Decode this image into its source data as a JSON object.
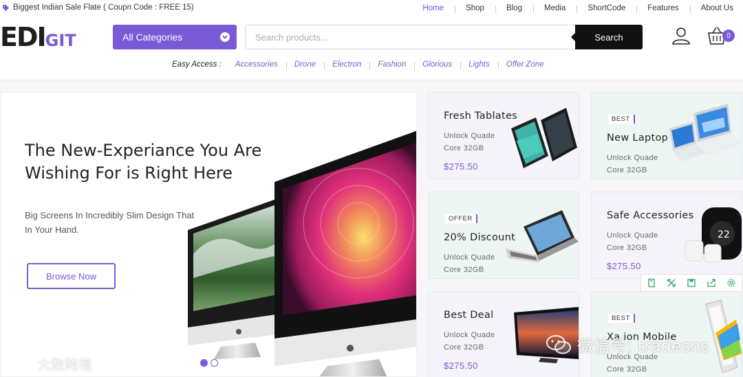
{
  "topbar": {
    "promo": "Biggest Indian Sale Flate ( Coupn Code : FREE 15)",
    "nav": [
      "Home",
      "Shop",
      "Blog",
      "Media",
      "ShortCode",
      "Features",
      "About Us"
    ],
    "active_nav": "Home"
  },
  "logo": {
    "main": "EDI",
    "accent": "GIT"
  },
  "header": {
    "categories_label": "All Categories",
    "search_placeholder": "Search products...",
    "search_button": "Search",
    "cart_count": "0"
  },
  "easy_access": {
    "label": "Easy Access :",
    "links": [
      "Accessories",
      "Drone",
      "Electron",
      "Fashion",
      "Glorious",
      "Lights",
      "Offer Zone"
    ]
  },
  "hero": {
    "title": "The New-Experiance You Are Wishing For is Right Here",
    "subtitle": "Big Screens In Incredibly Slim Design That In Your Hand.",
    "button": "Browse Now",
    "slides_total": 2,
    "slide_active": 1
  },
  "products": [
    {
      "badge": "",
      "name": "Fresh Tablates",
      "desc": "Unlock Quade Core 32GB",
      "price": "$275.50",
      "image": "tablet-image"
    },
    {
      "badge": "BEST",
      "name": "New Laptop",
      "desc": "Unlock Quade Core 32GB",
      "price": "",
      "image": "laptop-image"
    },
    {
      "badge": "OFFER",
      "name": "20% Discount",
      "desc": "Unlock Quade Core 32GB",
      "price": "",
      "image": "keyboard-tablet-image"
    },
    {
      "badge": "",
      "name": "Safe Accessories",
      "desc": "Unlock Quade Core 32GB",
      "price": "$275.50",
      "image": "thermostat-image"
    },
    {
      "badge": "",
      "name": "Best Deal",
      "desc": "Unlock Quade Core 32GB",
      "price": "$275.50",
      "image": "tv-image"
    },
    {
      "badge": "BEST",
      "name": "Xa  ion Mobile",
      "desc": "Unlock Quade Core 32GB",
      "price": "",
      "image": "phone-image"
    }
  ],
  "tools": [
    "bookmark-icon",
    "expand-icon",
    "save-icon",
    "share-icon",
    "settings-icon"
  ],
  "watermarks": {
    "left": "大数跨境",
    "right": "微信号: tradesns"
  },
  "colors": {
    "accent": "#7a5ad6",
    "dark": "#111111",
    "card_lilac": "#f6f4fb",
    "card_mint": "#eef6f4"
  }
}
